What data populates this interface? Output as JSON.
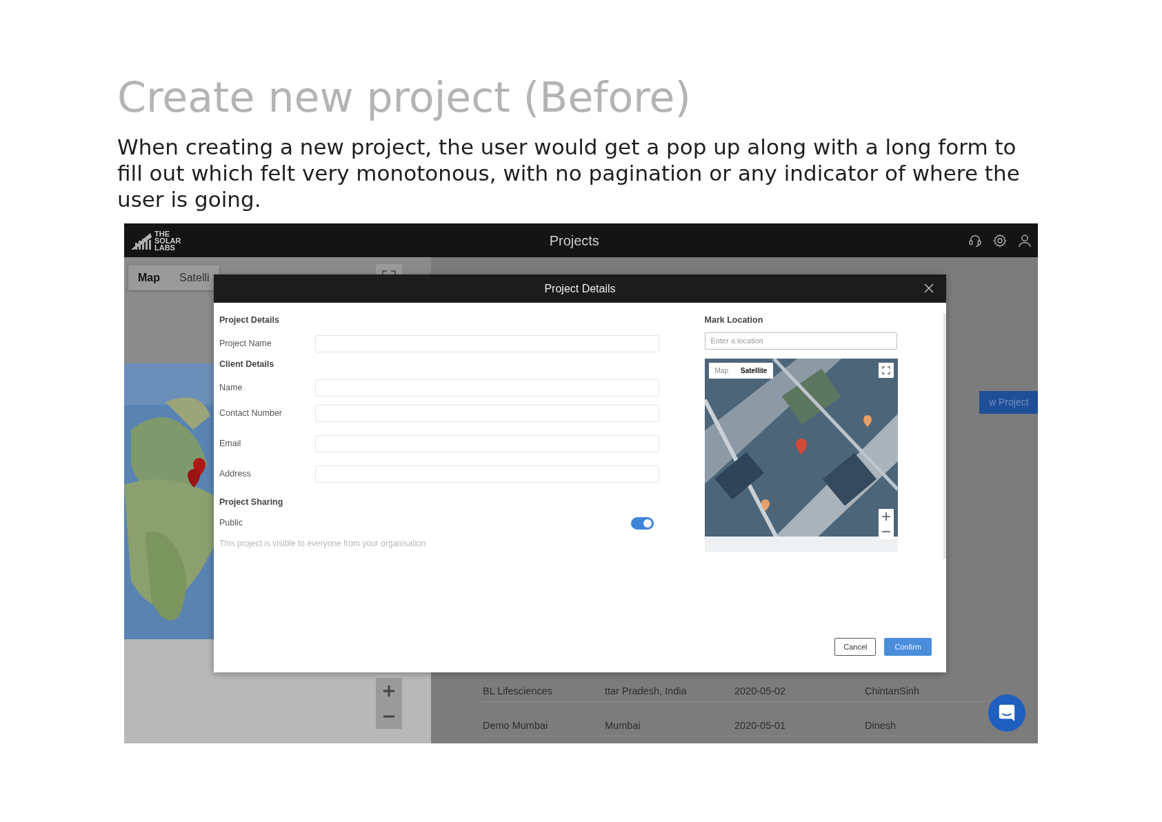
{
  "slide": {
    "title": "Create new project (Before)",
    "description": "When creating a new project, the user would get a pop up along with a long form to fill out which felt very monotonous, with no pagination or any indicator of where the user is going."
  },
  "app": {
    "logo": "THE SOLAR LABS",
    "title": "Projects",
    "map_types": [
      {
        "label": "Map",
        "selected": true
      },
      {
        "label": "Satelli",
        "selected": false
      }
    ],
    "new_project_button": "w Project",
    "table_rows": [
      {
        "cells": [
          "BL Lifesciences",
          "ttar Pradesh, India",
          "2020-05-02",
          "ChintanSinh"
        ]
      },
      {
        "cells": [
          "Demo Mumbai",
          "Mumbai",
          "2020-05-01",
          "Dinesh"
        ]
      }
    ]
  },
  "modal": {
    "title": "Project Details",
    "sections": [
      {
        "heading": "Project Details",
        "fields": [
          {
            "label": "Project Name"
          }
        ]
      },
      {
        "heading": "Client Details",
        "fields": [
          {
            "label": "Name"
          },
          {
            "label": "Contact Number"
          },
          {
            "label": "Email"
          },
          {
            "label": "Address"
          }
        ]
      }
    ],
    "sharing": {
      "heading": "Project Sharing",
      "label": "Public",
      "on": true,
      "help": "This project is visible to everyone from your organisation"
    },
    "location": {
      "heading": "Mark Location",
      "placeholder": "Enter a location",
      "map_types": [
        {
          "label": "Map",
          "selected": false
        },
        {
          "label": "Satellite",
          "selected": true
        }
      ]
    },
    "buttons": [
      {
        "label": "Cancel",
        "kind": "secondary"
      },
      {
        "label": "Confirm",
        "kind": "primary"
      }
    ]
  }
}
